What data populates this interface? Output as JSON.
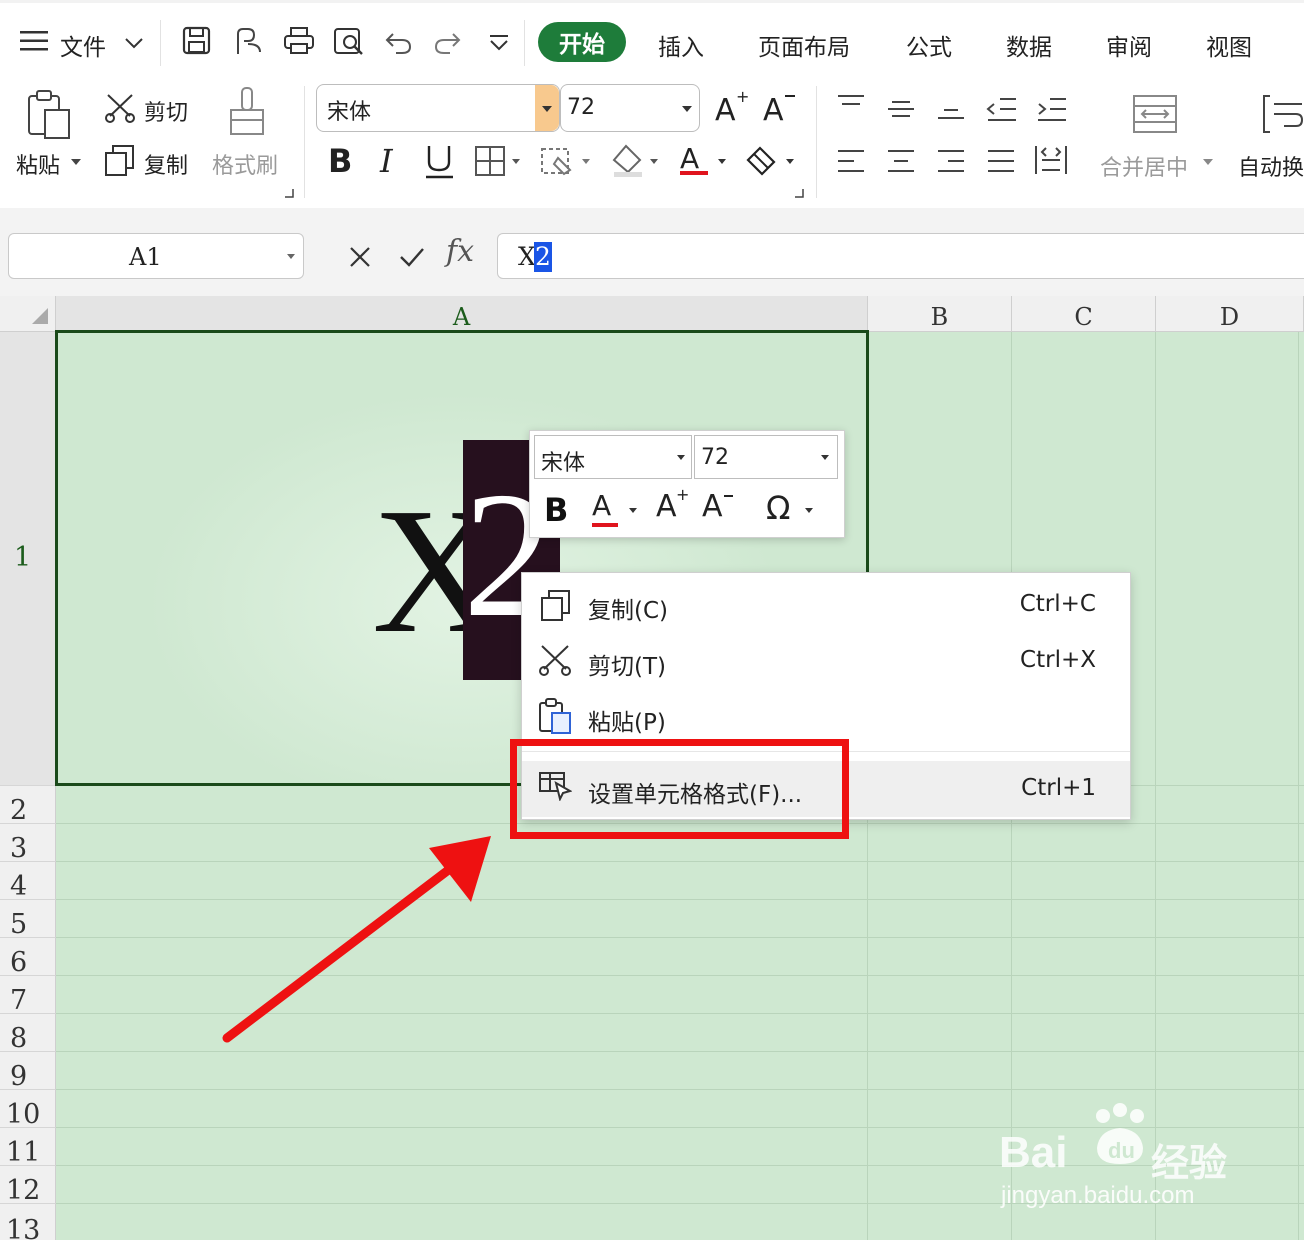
{
  "menubar": {
    "file_label": "文件",
    "tabs": [
      "开始",
      "插入",
      "页面布局",
      "公式",
      "数据",
      "审阅",
      "视图"
    ]
  },
  "ribbon": {
    "paste_label": "粘贴",
    "cut_label": "剪切",
    "copy_label": "复制",
    "format_painter_label": "格式刷",
    "font_name": "宋体",
    "font_size": "72",
    "merge_label": "合并居中",
    "wrap_label": "自动换"
  },
  "formula_bar": {
    "cell_ref": "A1",
    "fx_label": "fx",
    "content_plain": "X",
    "content_selected": "2"
  },
  "grid": {
    "columns": [
      "A",
      "B",
      "C",
      "D"
    ],
    "rows": [
      "1",
      "2",
      "3",
      "4",
      "5",
      "6",
      "7",
      "8",
      "9",
      "10",
      "11",
      "12",
      "13"
    ],
    "cell_a1_base": "X",
    "cell_a1_selected": "2",
    "background_color": "#cfe8d1",
    "selection_color": "#1a4a1a"
  },
  "mini_toolbar": {
    "font_name": "宋体",
    "font_size": "72",
    "bold_label": "B",
    "font_color_label": "A",
    "grow_label": "A",
    "shrink_label": "A",
    "symbol_label": "Ω"
  },
  "context_menu": {
    "items": [
      {
        "label": "复制(C)",
        "shortcut": "Ctrl+C",
        "icon": "copy-icon"
      },
      {
        "label": "剪切(T)",
        "shortcut": "Ctrl+X",
        "icon": "scissors-icon"
      },
      {
        "label": "粘贴(P)",
        "shortcut": "",
        "icon": "paste-icon"
      },
      {
        "label": "设置单元格格式(F)...",
        "shortcut": "Ctrl+1",
        "icon": "format-cells-icon"
      }
    ]
  },
  "annotation": {
    "box_color": "#ee1111",
    "arrow_color": "#ee1111"
  },
  "watermark": {
    "brand": "Bai",
    "brand_suffix": "经验",
    "url": "jingyan.baidu.com"
  },
  "colors": {
    "accent": "#1e7c3a",
    "font_color_underline": "#e0141e"
  }
}
